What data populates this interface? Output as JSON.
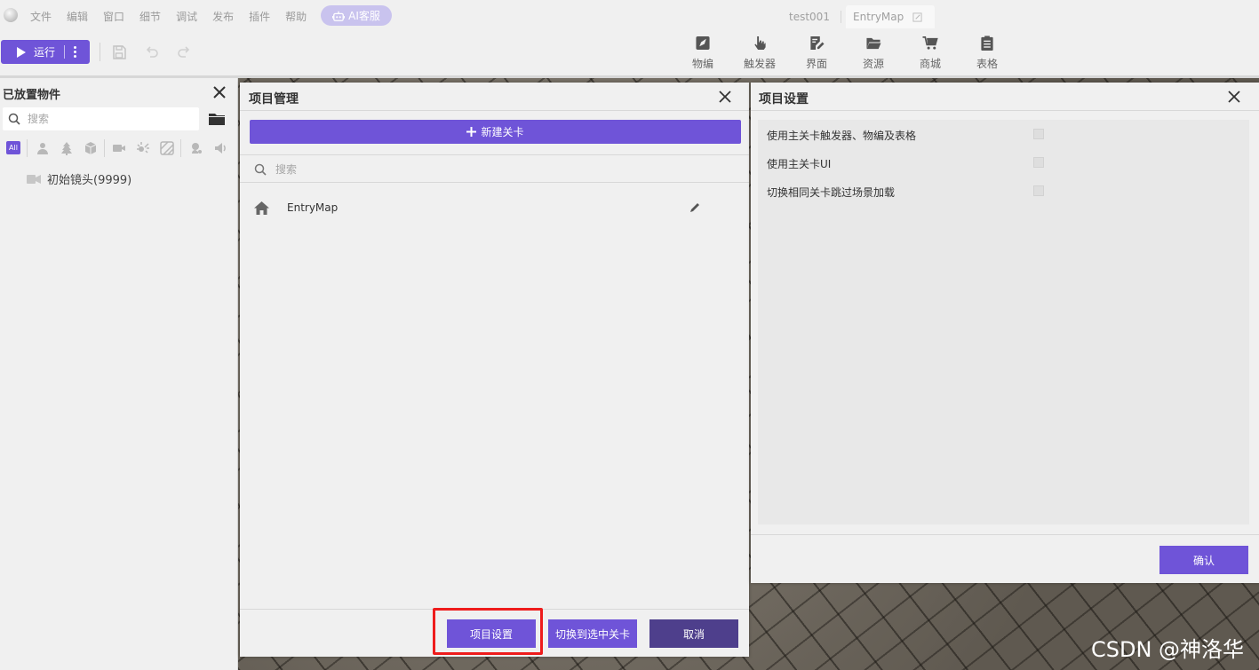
{
  "menubar": {
    "items": [
      "文件",
      "编辑",
      "窗口",
      "细节",
      "调试",
      "发布",
      "插件",
      "帮助"
    ],
    "ai_label": "AI客服",
    "project_tab": "test001",
    "map_tab": "EntryMap"
  },
  "toolbar": {
    "run_label": "运行",
    "tools": [
      "物编",
      "触发器",
      "界面",
      "资源",
      "商城",
      "表格"
    ]
  },
  "left_panel": {
    "title": "已放置物件",
    "search_placeholder": "搜索",
    "filter_all": "All",
    "tree_item": "初始镜头(9999)"
  },
  "project_manager": {
    "title": "项目管理",
    "new_level_label": "新建关卡",
    "search_placeholder": "搜索",
    "levels": [
      "EntryMap"
    ],
    "buttons": {
      "settings": "项目设置",
      "switch": "切换到选中关卡",
      "cancel": "取消"
    }
  },
  "project_settings": {
    "title": "项目设置",
    "options": [
      {
        "label": "使用主关卡触发器、物编及表格",
        "checked": false
      },
      {
        "label": "使用主关卡UI",
        "checked": false
      },
      {
        "label": "切换相同关卡跳过场景加载",
        "checked": false
      }
    ],
    "confirm_label": "确认"
  },
  "watermark": "CSDN @神洛华",
  "colors": {
    "accent": "#6f54d8",
    "accent_dark": "#4e3f8c",
    "highlight": "#ee1c1c"
  }
}
